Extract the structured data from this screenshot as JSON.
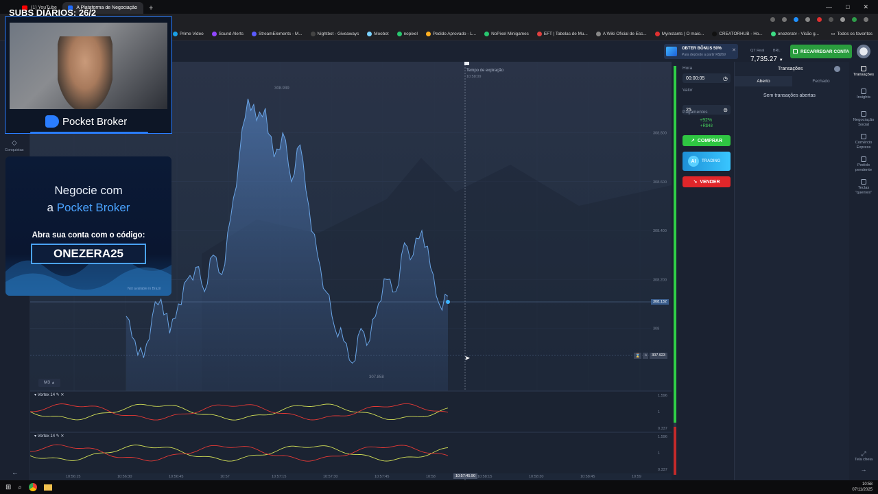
{
  "browser": {
    "tabs": [
      {
        "label": "(1) YouTube",
        "color": "#ff0000",
        "active": false
      },
      {
        "label": "A Plataforma de Negociação M",
        "color": "#1e6bff",
        "active": true
      }
    ],
    "new_tab": "+"
  },
  "bookmarks": [
    {
      "label": "Prime Video",
      "color": "#1aa0e6"
    },
    {
      "label": "Sound Alerts",
      "color": "#9146ff"
    },
    {
      "label": "StreamElements - M...",
      "color": "#5b5bff"
    },
    {
      "label": "Nightbot - Giveaways",
      "color": "#444"
    },
    {
      "label": "Moobot",
      "color": "#7bd3ff"
    },
    {
      "label": "nopixel",
      "color": "#28c76f"
    },
    {
      "label": "Pedido Aprovado - L...",
      "color": "#ffb020"
    },
    {
      "label": "NoPixel Minigames",
      "color": "#28c76f"
    },
    {
      "label": "EFT | Tabelas de Mu...",
      "color": "#e04040"
    },
    {
      "label": "A Wiki Oficial de Esc...",
      "color": "#888"
    },
    {
      "label": "Myinstants | O maio...",
      "color": "#e03030"
    },
    {
      "label": "CREATORHUB - Ho...",
      "color": "#111"
    },
    {
      "label": "onezeratv - Visão g...",
      "color": "#3ddc84"
    }
  ],
  "bookmarks_all": "Todos os favoritos",
  "overlay": {
    "subs": "SUBS DIÁRIOS: 26/2",
    "brand": "Pocket Broker",
    "promo_line1": "Negocie com",
    "promo_line2_prefix": "a ",
    "promo_line2_brand": "Pocket Broker",
    "promo_cta": "Abra sua conta com o código:",
    "promo_code": "ONEZERA25",
    "promo_note": "Not available in Brazil"
  },
  "header": {
    "bonus_title": "OBTER BÔNUS 50%",
    "bonus_sub": "Para depósito a partir R$269",
    "account_type": "QT Real",
    "currency": "BRL",
    "balance": "7,735.27",
    "recharge_label": "RECARREGAR CONTA"
  },
  "leftbar": {
    "achievements": "Conquistas"
  },
  "chart": {
    "expiry_label": "Tempo de expiração",
    "expiry_time": "10:58:09",
    "timeframe": "M3",
    "current_price": "308.132",
    "hover_price": "307.923",
    "high_label": "308.939",
    "low_label": "307.858",
    "hover_time": "10:57:45.90",
    "indicator1": "Vortex 14",
    "indicator2": "Vortex 14"
  },
  "chart_data": {
    "type": "area",
    "title": "",
    "ylabel": "",
    "xlabel": "",
    "y_ticks": [
      "308.800",
      "308.600",
      "308.400",
      "308.200",
      "308"
    ],
    "x_ticks": [
      "10:56:15",
      "10:56:30",
      "10:56:45",
      "10:57",
      "10:57:15",
      "10:57:30",
      "10:57:45",
      "10:58",
      "10:58:15",
      "10:58:30",
      "10:58:45",
      "10:59"
    ],
    "ylim": [
      307.8,
      308.95
    ],
    "series": [
      {
        "values": [
          308.05,
          307.95,
          307.88,
          308.05,
          308.12,
          307.98,
          308.1,
          308.2,
          308.25,
          308.15,
          308.3,
          308.22,
          308.45,
          308.7,
          308.939,
          308.85,
          308.9,
          308.7,
          308.8,
          308.6,
          308.75,
          308.5,
          308.3,
          308.15,
          308.0,
          307.95,
          307.858,
          308.0,
          307.95,
          308.1,
          308.2,
          308.15,
          308.35,
          308.3,
          308.4,
          308.25,
          308.1,
          308.132
        ]
      }
    ],
    "indicator_ticks": [
      "1.596",
      "1",
      "0.337"
    ]
  },
  "tradepanel": {
    "time_label": "Hora",
    "time_value": "00:00:05",
    "amount_label": "Valor",
    "amount_value": "25",
    "payout_label": "Pagamentos",
    "payout_pct": "+92%",
    "payout_value": "+R$48",
    "buy_label": "COMPRAR",
    "ai_label": "AI",
    "ai_sub": "TRADING",
    "sell_label": "VENDER"
  },
  "transactions": {
    "title": "Transações",
    "tab_open": "Aberto",
    "tab_closed": "Fechado",
    "empty": "Sem transações abertas"
  },
  "rightnav": [
    {
      "label": "Transações",
      "icon": "history-icon"
    },
    {
      "label": "Insights",
      "icon": "insights-icon"
    },
    {
      "label": "Negociação Social",
      "icon": "social-icon"
    },
    {
      "label": "Comércio Express",
      "icon": "express-icon"
    },
    {
      "label": "Pedido pendente",
      "icon": "hourglass-icon"
    },
    {
      "label": "Teclas \"quentes\"",
      "icon": "keyboard-icon"
    }
  ],
  "fullscreen": "Tela cheia",
  "taskbar": {
    "time": "10:58",
    "date": "07/11/2025"
  }
}
